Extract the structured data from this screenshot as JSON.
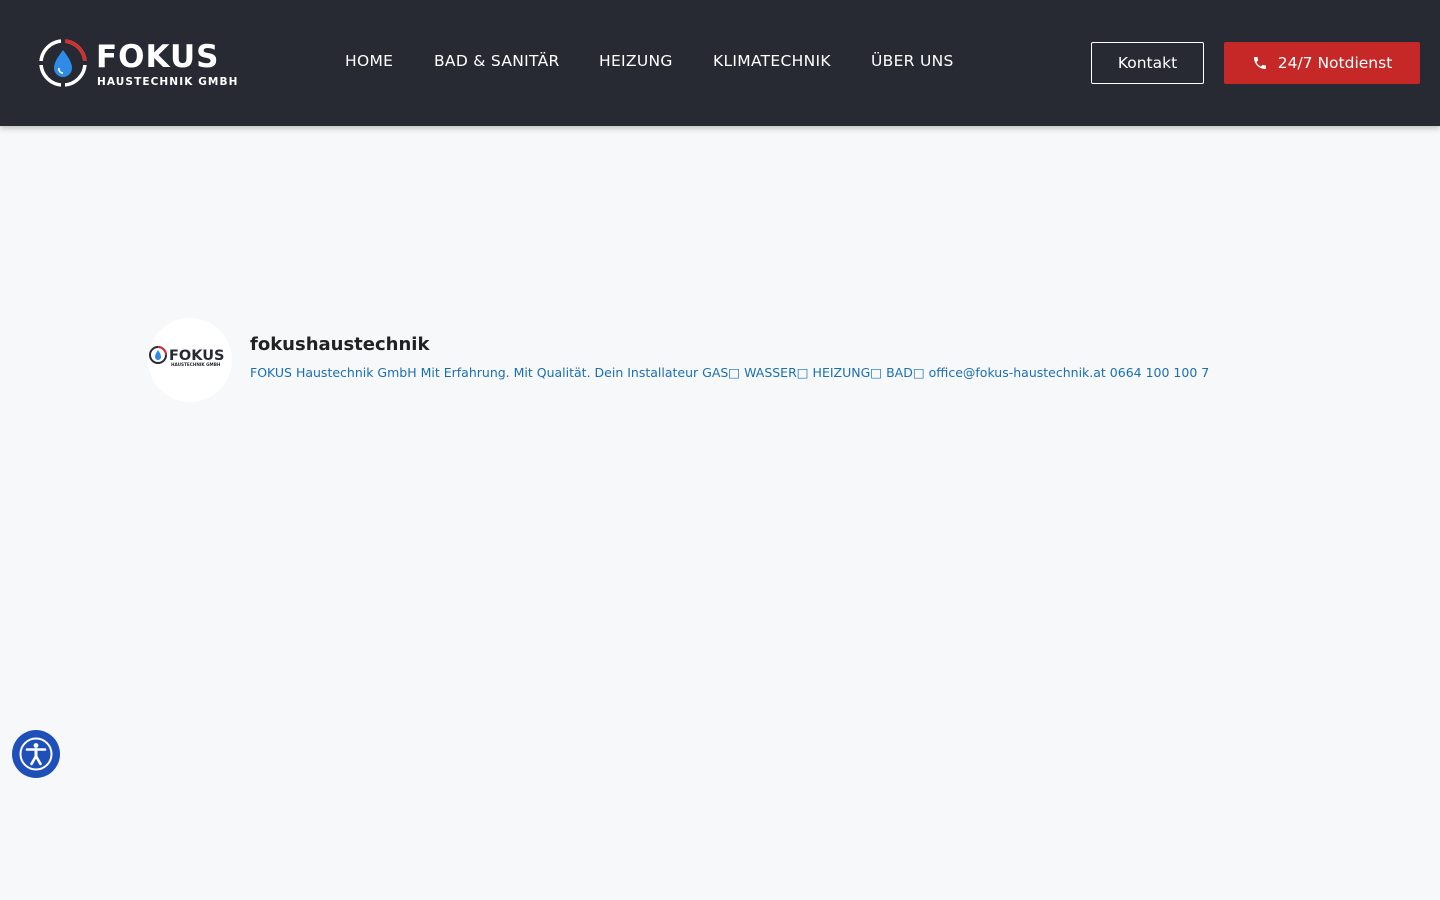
{
  "header": {
    "logo": {
      "brand": "FOKUS",
      "sub": "HAUSTECHNIK GMBH"
    },
    "nav": [
      {
        "label": "HOME"
      },
      {
        "label": "BAD & SANITÄR"
      },
      {
        "label": "HEIZUNG"
      },
      {
        "label": "KLIMATECHNIK"
      },
      {
        "label": "ÜBER UNS"
      }
    ],
    "kontakt_label": "Kontakt",
    "notdienst_label": "24/7 Notdienst"
  },
  "profile": {
    "avatar_brand": "FOKUS",
    "avatar_sub": "HAUSTECHNIK GMBH",
    "username": "fokushaustechnik",
    "bio": "FOKUS Haustechnik GmbH Mit Erfahrung. Mit Qualität. Dein Installateur GAS□ WASSER□ HEIZUNG□ BAD□ office@fokus-haustechnik.at 0664 100 100 7"
  },
  "colors": {
    "header_bg": "#272a33",
    "accent_red": "#c62828",
    "link_blue": "#1a6fb3",
    "a11y_blue": "#1f4fb8",
    "drop_blue": "#2e8be6"
  },
  "icons": {
    "logo": "fokus-logo-icon",
    "phone": "phone-icon",
    "accessibility": "accessibility-icon"
  }
}
